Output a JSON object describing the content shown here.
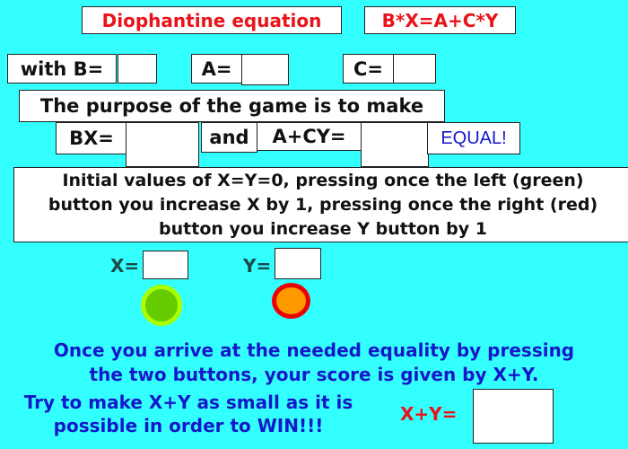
{
  "header": {
    "title": "Diophantine equation",
    "equation": "B*X=A+C*Y"
  },
  "params": {
    "b_label": "with B=",
    "b_value": "",
    "a_label": "A=",
    "a_value": "",
    "c_label": "C=",
    "c_value": ""
  },
  "purpose": {
    "line": "The purpose of the game is to make",
    "bx_label": "BX=",
    "bx_value": "",
    "and_label": "and",
    "acy_label": "A+CY=",
    "acy_value": "",
    "equal_label": "EQUAL!"
  },
  "instructions": {
    "line1": "Initial values of X=Y=0, pressing once the left (green)",
    "line2": "button you increase X by 1,  pressing once the right (red)",
    "line3": "button you increase Y button by 1"
  },
  "counters": {
    "x_label": "X=",
    "x_value": "",
    "y_label": "Y=",
    "y_value": "",
    "green_button_color": "#66cc00",
    "green_ring_color": "#aaff00",
    "red_button_color": "#ff9900",
    "red_ring_color": "#ee0000"
  },
  "footer": {
    "line1": "Once you arrive at the needed equality by pressing",
    "line2": "the two buttons, your score is given by X+Y.",
    "line3": "Try to make X+Y as small as it is",
    "line4": "possible in order to WIN!!!",
    "score_label": "X+Y=",
    "score_value": ""
  }
}
